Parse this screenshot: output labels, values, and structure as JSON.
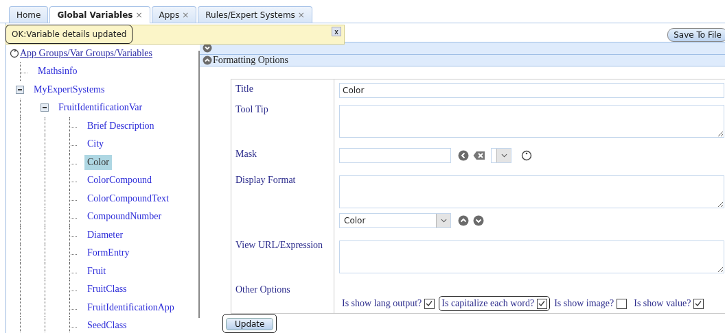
{
  "tabs": [
    {
      "label": "Home",
      "selected": false
    },
    {
      "label": "Global Variables",
      "close": "×",
      "selected": true
    },
    {
      "label": "Apps",
      "close": "×",
      "selected": false
    },
    {
      "label": "Rules/Expert Systems",
      "close": "×",
      "selected": false
    }
  ],
  "toast": {
    "message": "OK:Variable details updated",
    "highlighted": true,
    "close": "x"
  },
  "tree": {
    "root": "App Groups/Var Groups/Variables",
    "items": [
      {
        "label": "Mathsinfo",
        "selected": false
      },
      {
        "label": "MyExpertSystems",
        "expanded": true,
        "selected": false,
        "children": [
          {
            "label": "FruitIdentificationVar",
            "expanded": true,
            "selected": false,
            "children": [
              {
                "label": "Brief Description",
                "selected": false
              },
              {
                "label": "City",
                "selected": false
              },
              {
                "label": "Color",
                "selected": true
              },
              {
                "label": "ColorCompound",
                "selected": false
              },
              {
                "label": "ColorCompoundText",
                "selected": false
              },
              {
                "label": "CompoundNumber",
                "selected": false
              },
              {
                "label": "Diameter",
                "selected": false
              },
              {
                "label": "FormEntry",
                "selected": false
              },
              {
                "label": "Fruit",
                "selected": false
              },
              {
                "label": "FruitClass",
                "selected": false
              },
              {
                "label": "FruitIdentificationApp",
                "selected": false
              },
              {
                "label": "SeedClass",
                "selected": false
              }
            ]
          }
        ]
      }
    ]
  },
  "save_button": "Save To File",
  "sections": [
    {
      "expanded": false
    },
    {
      "title": "Formatting Options",
      "expanded": true
    }
  ],
  "form": {
    "rows": [
      {
        "label": "Title",
        "kind": "text",
        "value": "Color"
      },
      {
        "label": "Tool Tip",
        "kind": "textarea"
      },
      {
        "label": "Mask",
        "kind": "mask"
      },
      {
        "label": "Display Format",
        "kind": "format",
        "select_value": "Color"
      },
      {
        "label": "View URL/Expression",
        "kind": "textarea"
      },
      {
        "label": "Other Options",
        "kind": "options",
        "options": [
          {
            "label": "Is show lang output?",
            "checked": true,
            "highlighted": false
          },
          {
            "label": "Is capitalize each word?",
            "checked": true,
            "highlighted": true
          },
          {
            "label": "Is show image?",
            "checked": false,
            "highlighted": false
          },
          {
            "label": "Is show value?",
            "checked": true,
            "highlighted": false
          }
        ]
      }
    ]
  },
  "update_button": {
    "label": "Update",
    "highlighted": true
  }
}
